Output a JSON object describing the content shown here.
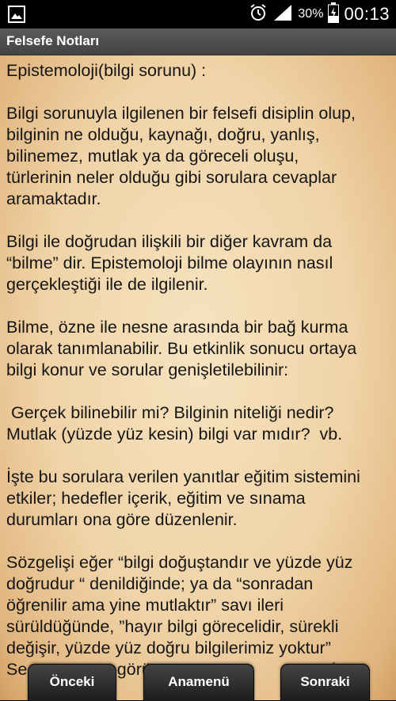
{
  "status_bar": {
    "battery_percent": "30%",
    "time": "00:13",
    "icons": [
      "gallery-icon",
      "alarm-icon",
      "signal-icon",
      "battery-charging-icon"
    ]
  },
  "app_bar": {
    "title": "Felsefe Notları"
  },
  "content": {
    "heading": "Epistemoloji(bilgi sorunu) :",
    "paragraphs": [
      [
        "Bilgi sorunuyla ilgilenen bir felsefi disiplin olup,",
        "bilginin ne olduğu, kaynağı, doğru, yanlış,",
        "bilinemez, mutlak ya da göreceli oluşu,",
        "türlerinin neler olduğu gibi sorulara cevaplar",
        "aramaktadır."
      ],
      [
        "Bilgi ile doğrudan ilişkili bir diğer kavram da",
        "“bilme” dir. Epistemoloji bilme olayının nasıl",
        "gerçekleştiği ile de ilgilenir."
      ],
      [
        "Bilme, özne ile nesne arasında bir bağ kurma",
        "olarak tanımlanabilir. Bu etkinlik sonucu ortaya",
        "bilgi konur ve sorular genişletilebilinir:"
      ],
      [
        " Gerçek bilinebilir mi? Bilginin niteliği nedir?",
        "Mutlak (yüzde yüz kesin) bilgi var mıdır?  vb."
      ],
      [
        "İşte bu sorulara verilen yanıtlar eğitim sistemini",
        "etkiler; hedefler içerik, eğitim ve sınama",
        "durumları ona göre düzenlenir."
      ],
      [
        "Sözgelişi eğer “bilgi doğuştandır ve yüzde yüz",
        "doğrudur “ denildiğinde; ya da “sonradan",
        "öğrenilir ama yine mutlaktır” savı ileri",
        "sürüldüğünde, ”hayır bilgi görecelidir, sürekli",
        "değişir, yüzde yüz doğru bilgilerimiz yoktur”",
        "Se                   görü                                 unda"
      ]
    ]
  },
  "buttons": {
    "prev": "Önceki",
    "menu": "Anamenü",
    "next": "Sonraki"
  },
  "colors": {
    "status_bar": "#000000",
    "app_bar": "#4a4a4a",
    "paper": "#f0d3a7",
    "text": "#151515",
    "button": "#2a2a2a"
  }
}
